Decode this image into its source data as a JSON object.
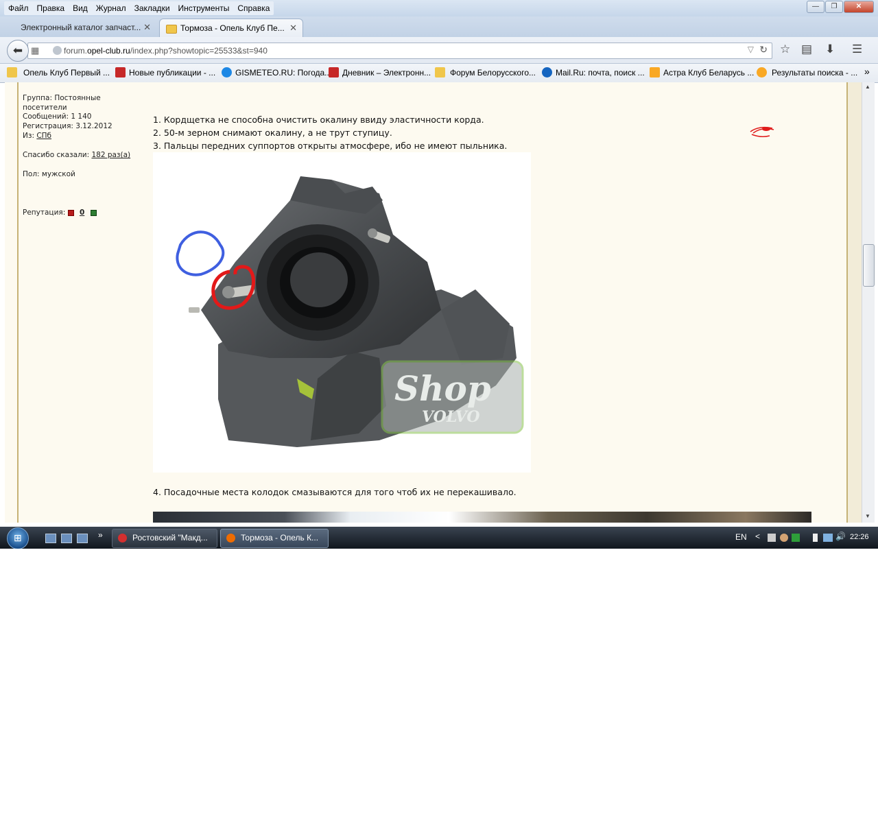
{
  "window": {
    "menu": [
      "Файл",
      "Правка",
      "Вид",
      "Журнал",
      "Закладки",
      "Инструменты",
      "Справка"
    ],
    "controls": {
      "minimize": "—",
      "maximize": "❐",
      "close": "✕"
    }
  },
  "tabs": [
    {
      "title": "Электронный каталог запчаст...",
      "active": false
    },
    {
      "title": "Тормоза - Опель Клуб Пе...",
      "active": true
    }
  ],
  "new_tab": "+",
  "url": {
    "prefix": "forum.",
    "host": "opel-club.ru",
    "path": "/index.php?showtopic=25533&st=940"
  },
  "bookmarks": [
    {
      "label": "Опель Клуб Первый ...",
      "icon": "folder-icon",
      "color": "#f0c64b"
    },
    {
      "label": "Новые публикации - ...",
      "icon": "onliner-icon",
      "color": "#c62828"
    },
    {
      "label": "GISMETEO.RU: Погода...",
      "icon": "gismeteo-icon",
      "color": "#1e88e5"
    },
    {
      "label": "Дневник – Электронн...",
      "icon": "dnevnik-icon",
      "color": "#c62828"
    },
    {
      "label": "Форум Белорусского...",
      "icon": "forum-icon",
      "color": "#f0c64b"
    },
    {
      "label": "Mail.Ru: почта, поиск ...",
      "icon": "mailru-icon",
      "color": "#1565c0"
    },
    {
      "label": "Астра Клуб Беларусь ...",
      "icon": "astra-icon",
      "color": "#f9a825"
    },
    {
      "label": "Результаты поиска - ...",
      "icon": "opel-icon",
      "color": "#f9a825"
    }
  ],
  "bookmarks_overflow": "»",
  "profile": {
    "group_label": "Группа:",
    "group_value": "Постоянные посетители",
    "posts": "Сообщений: 1 140",
    "registered": "Регистрация: 3.12.2012",
    "from_label": "Из:",
    "from_value": "СПб",
    "thanks_label": "Спасибо сказали:",
    "thanks_value": "182 раз(а)",
    "gender": "Пол: мужской",
    "reputation_label": "Репутация:",
    "reputation_value": "0"
  },
  "post": {
    "lines": [
      "1. Кордщетка не способна очистить окалину ввиду эластичности корда.",
      "2. 50-м зерном снимают окалину, а не трут ступицу.",
      "3. Пальцы передних суппортов открыты атмосфере, ибо не имеют пыльника."
    ],
    "line4": "4. Посадочные места колодок смазываются для того чтоб их не перекашивало.",
    "watermark_shop": "Shop",
    "watermark_volvo": "VOLVO"
  },
  "taskbar": {
    "start": "⊞",
    "overflow": "»",
    "buttons": [
      {
        "label": "Ростовский \"Макд...",
        "icon": "opera-icon",
        "color": "#d32f2f",
        "active": false
      },
      {
        "label": "Тормоза - Опель К...",
        "icon": "firefox-icon",
        "color": "#ef6c00",
        "active": true
      }
    ],
    "lang": "EN",
    "tray_chevron": "<",
    "volume": "🔊",
    "clock": "22:26"
  }
}
